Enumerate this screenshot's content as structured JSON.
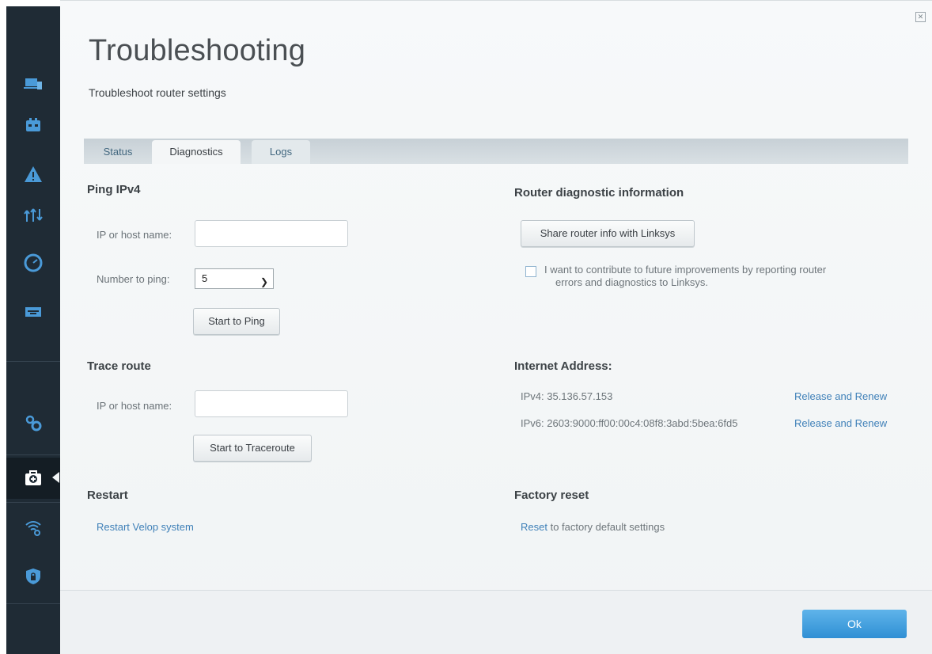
{
  "header": {
    "title": "Troubleshooting",
    "subtitle": "Troubleshoot router settings"
  },
  "tabs": [
    {
      "label": "Status",
      "active": false
    },
    {
      "label": "Diagnostics",
      "active": true
    },
    {
      "label": "Logs",
      "active": false
    }
  ],
  "sidebar": {
    "items": [
      {
        "icon": "devices-icon"
      },
      {
        "icon": "parental-controls-icon"
      },
      {
        "icon": "alert-icon"
      },
      {
        "icon": "media-prioritization-icon"
      },
      {
        "icon": "speed-test-icon"
      },
      {
        "icon": "usb-storage-icon"
      },
      {
        "icon": "settings-icon"
      },
      {
        "icon": "troubleshooting-icon",
        "active": true
      },
      {
        "icon": "wifi-settings-icon"
      },
      {
        "icon": "security-icon"
      }
    ]
  },
  "ping": {
    "heading": "Ping IPv4",
    "host_label": "IP or host name:",
    "host_value": "",
    "count_label": "Number to ping:",
    "count_value": "5",
    "button": "Start to Ping"
  },
  "trace": {
    "heading": "Trace route",
    "host_label": "IP or host name:",
    "host_value": "",
    "button": "Start to Traceroute"
  },
  "restart": {
    "heading": "Restart",
    "link": "Restart Velop system"
  },
  "diagnostic_info": {
    "heading": "Router diagnostic information",
    "button": "Share router info with Linksys",
    "checkbox_line1": "I want to contribute to future improvements by reporting router",
    "checkbox_line2": "errors and diagnostics to Linksys.",
    "checked": false
  },
  "internet_address": {
    "heading": "Internet Address:",
    "ipv4": "IPv4: 35.136.57.153",
    "ipv6": "IPv6: 2603:9000:ff00:00c4:08f8:3abd:5bea:6fd5",
    "release_renew": "Release and Renew"
  },
  "factory_reset": {
    "heading": "Factory reset",
    "link": "Reset",
    "text": " to factory default settings"
  },
  "footer": {
    "ok": "Ok"
  },
  "colors": {
    "sidebar_bg": "#1f2b35",
    "icon": "#4a9ad8",
    "link": "#3f80b8",
    "ok_button": "#3a98dc"
  }
}
